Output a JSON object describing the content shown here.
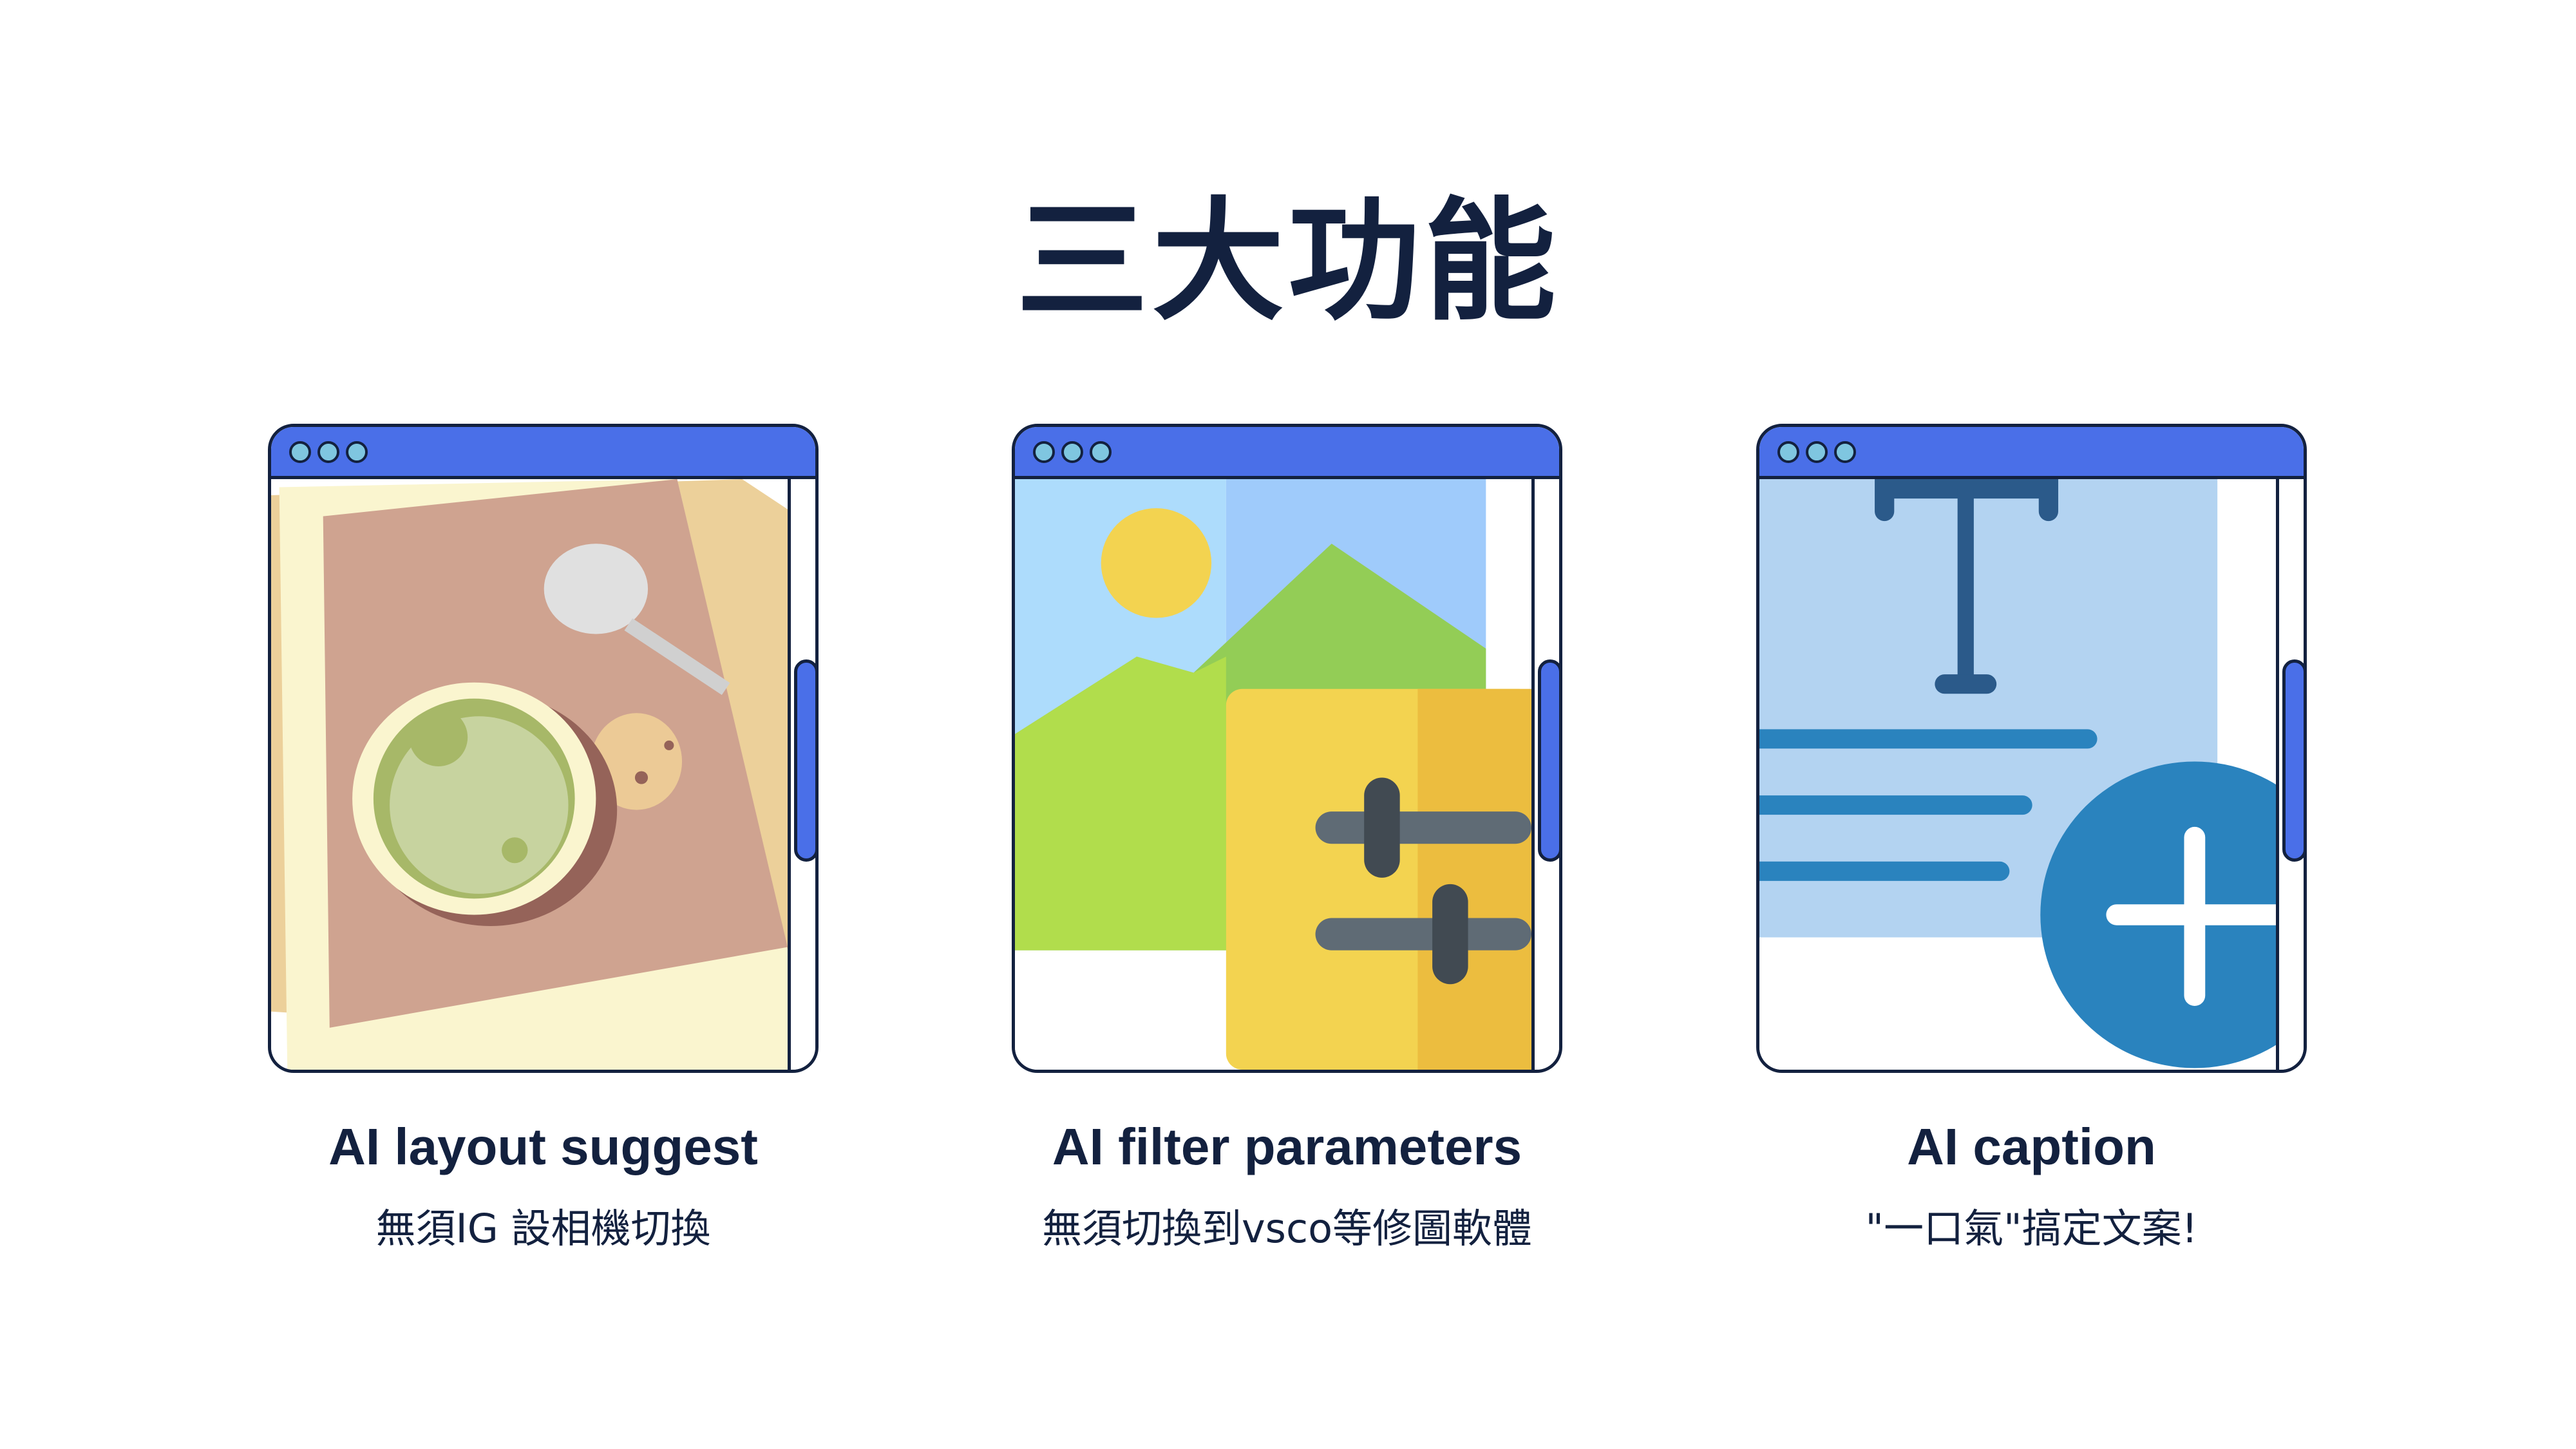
{
  "title": "三大功能",
  "features": [
    {
      "title": "AI layout suggest",
      "subtitle": "無須IG 設相機切換",
      "icon": "coffee-cup-photo-illustration"
    },
    {
      "title": "AI filter parameters",
      "subtitle": "無須切換到vsco等修圖軟體",
      "icon": "image-adjust-sliders-illustration"
    },
    {
      "title": "AI caption",
      "subtitle": "\"一口氣\"搞定文案!",
      "icon": "text-add-illustration"
    }
  ],
  "colors": {
    "accent": "#4a6fe8",
    "text": "#13213f"
  }
}
